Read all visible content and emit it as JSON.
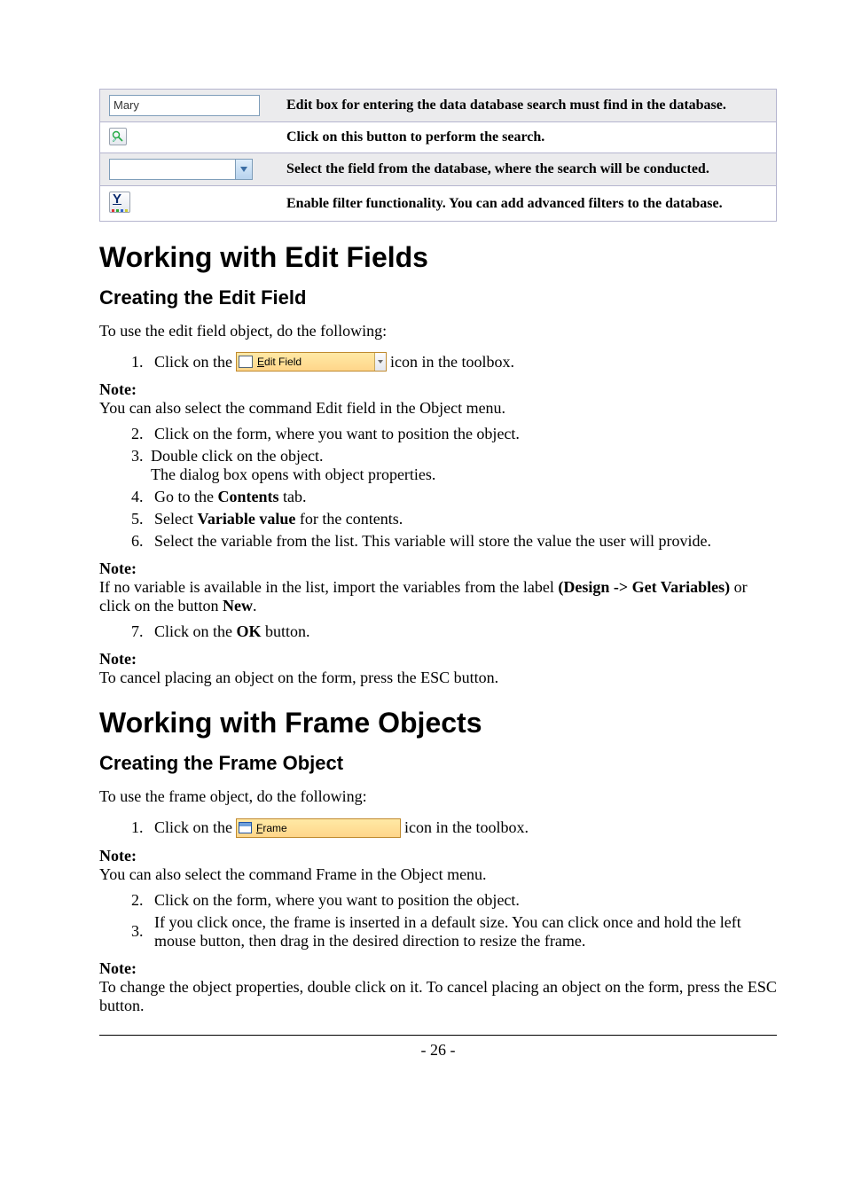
{
  "table": {
    "r1": {
      "input_text": "Mary",
      "desc": "Edit box for entering the data database search must find in the database."
    },
    "r2": {
      "desc": "Click on this button to perform the search."
    },
    "r3": {
      "desc": "Select the field from the database, where the search will be conducted."
    },
    "r4": {
      "desc": "Enable filter functionality. You can add advanced filters to the database."
    }
  },
  "h1a": "Working with Edit Fields",
  "h2a": "Creating the Edit Field",
  "p1": "To use the edit field object, do the following:",
  "ol1": {
    "n": "1.",
    "pre": "Click on the ",
    "btn_u": "E",
    "btn_rest": "dit Field",
    "post": " icon in the toolbox."
  },
  "note1": {
    "h": "Note:",
    "b": "You can also select the command Edit field in the Object menu."
  },
  "ol2": {
    "i2": {
      "n": "2.",
      "t": "Click on the form, where you want to position the object."
    },
    "i3": {
      "n": "3.",
      "t": "Double click on the object.",
      "sub": "The dialog box opens with object properties."
    },
    "i4": {
      "n": "4.",
      "pre": "Go to the ",
      "b": "Contents",
      "post": " tab."
    },
    "i5": {
      "n": "5.",
      "pre": "Select ",
      "b": "Variable value",
      "post": " for the contents."
    },
    "i6": {
      "n": "6.",
      "t": "Select the variable from the list. This variable will store the value the user will provide."
    }
  },
  "note2": {
    "h": "Note:",
    "pre": "If no variable is available in the list, import the variables from the label ",
    "b1": "(Design -> Get Variables)",
    "mid": " or click on the button ",
    "b2": "New",
    "post": "."
  },
  "ol3": {
    "n": "7.",
    "pre": "Click on the ",
    "b": "OK",
    "post": " button."
  },
  "note3": {
    "h": "Note:",
    "b": "To cancel placing an object on the form, press the ESC button."
  },
  "h1b": "Working with Frame Objects",
  "h2b": "Creating the Frame Object",
  "p2": "To use the frame object, do the following:",
  "ol4": {
    "n": "1.",
    "pre": "Click on the ",
    "btn_u": "F",
    "btn_rest": "rame",
    "post": " icon in the toolbox."
  },
  "note4": {
    "h": "Note:",
    "b": "You can also select the command Frame in the Object menu."
  },
  "ol5": {
    "i2": {
      "n": "2.",
      "t": "Click on the form, where you want to position the object."
    },
    "i3": {
      "n": "3.",
      "t": "If you click once, the frame is inserted in a default size. You can click once and hold the left mouse button, then drag in the desired direction to resize the frame."
    }
  },
  "note5": {
    "h": "Note:",
    "b": "To change the object properties, double click on it. To cancel placing an object on the form, press the ESC button."
  },
  "page_number": "- 26 -"
}
